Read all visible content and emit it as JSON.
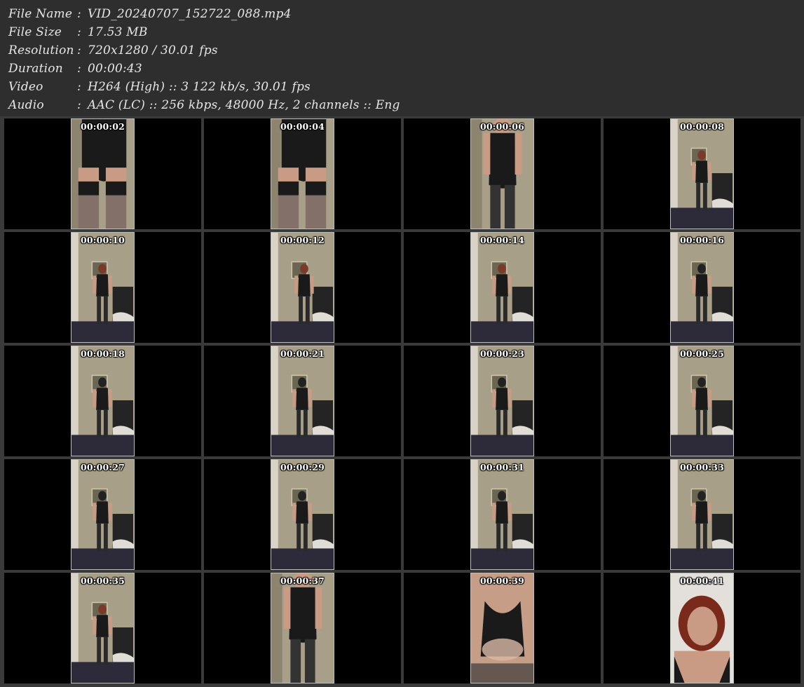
{
  "info": [
    {
      "label": "File Name",
      "sep": ":",
      "value": "VID_20240707_152722_088.mp4"
    },
    {
      "label": "File Size",
      "sep": ":",
      "value": "17.53 MB"
    },
    {
      "label": "Resolution",
      "sep": ":",
      "value": "720x1280 / 30.01 fps"
    },
    {
      "label": "Duration",
      "sep": ":",
      "value": "00:00:43"
    },
    {
      "label": "Video",
      "sep": ":",
      "value": "H264 (High) :: 3 122 kb/s, 30.01 fps"
    },
    {
      "label": "Audio",
      "sep": ":",
      "value": "AAC (LC) :: 256 kbps, 48000 Hz, 2 channels :: Eng"
    }
  ],
  "thumbnails": [
    {
      "time": "00:00:02",
      "scene": "closeup-legs"
    },
    {
      "time": "00:00:04",
      "scene": "closeup-legs"
    },
    {
      "time": "00:00:06",
      "scene": "mid"
    },
    {
      "time": "00:00:08",
      "scene": "room-far"
    },
    {
      "time": "00:00:10",
      "scene": "room-front"
    },
    {
      "time": "00:00:12",
      "scene": "room-side"
    },
    {
      "time": "00:00:14",
      "scene": "room-front"
    },
    {
      "time": "00:00:16",
      "scene": "room-back"
    },
    {
      "time": "00:00:18",
      "scene": "room-back"
    },
    {
      "time": "00:00:21",
      "scene": "room-bend"
    },
    {
      "time": "00:00:23",
      "scene": "room-bend"
    },
    {
      "time": "00:00:25",
      "scene": "room-back"
    },
    {
      "time": "00:00:27",
      "scene": "room-back"
    },
    {
      "time": "00:00:29",
      "scene": "room-back"
    },
    {
      "time": "00:00:31",
      "scene": "room-back"
    },
    {
      "time": "00:00:33",
      "scene": "room-back"
    },
    {
      "time": "00:00:35",
      "scene": "room-front"
    },
    {
      "time": "00:00:37",
      "scene": "mid"
    },
    {
      "time": "00:00:39",
      "scene": "closeup-torso"
    },
    {
      "time": "00:00:41",
      "scene": "face"
    }
  ],
  "colors": {
    "header_bg": "#2e2e2e",
    "grid_bg": "#3a3a3a",
    "cell_bg": "#000000",
    "text": "#e6e6e6",
    "timestamp": "#ffffff"
  }
}
